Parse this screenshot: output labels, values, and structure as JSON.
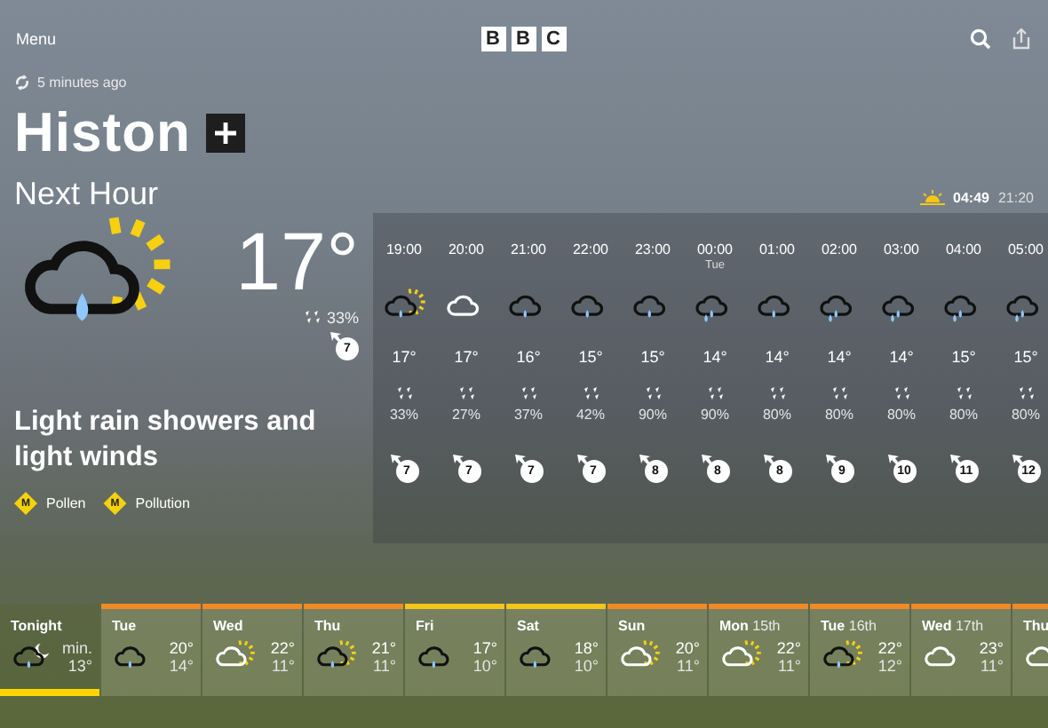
{
  "top_bar": {
    "menu": "Menu",
    "logo": [
      "B",
      "B",
      "C"
    ]
  },
  "header": {
    "updated": "5 minutes ago",
    "location": "Histon",
    "section": "Next Hour",
    "sunrise": "04:49",
    "sunset": "21:20"
  },
  "now": {
    "kind": "sun-cloud-rain",
    "temperature": "17°",
    "rain": "33%",
    "wind": "7",
    "description": "Light rain showers and light winds",
    "badges": [
      {
        "level": "M",
        "label": "Pollen"
      },
      {
        "level": "M",
        "label": "Pollution"
      }
    ]
  },
  "hours": [
    {
      "time": "19:00",
      "kind": "sun-cloud-rain",
      "temp": "17°",
      "rain": "33%",
      "wind": "7"
    },
    {
      "time": "20:00",
      "kind": "cloud",
      "temp": "17°",
      "rain": "27%",
      "wind": "7"
    },
    {
      "time": "21:00",
      "kind": "cloud-rain",
      "temp": "16°",
      "rain": "37%",
      "wind": "7"
    },
    {
      "time": "22:00",
      "kind": "cloud-rain",
      "temp": "15°",
      "rain": "42%",
      "wind": "7"
    },
    {
      "time": "23:00",
      "kind": "cloud-rain",
      "temp": "15°",
      "rain": "90%",
      "wind": "8"
    },
    {
      "time": "00:00",
      "day": "Tue",
      "kind": "cloud-heavy-rain",
      "temp": "14°",
      "rain": "90%",
      "wind": "8"
    },
    {
      "time": "01:00",
      "kind": "cloud-rain",
      "temp": "14°",
      "rain": "80%",
      "wind": "8"
    },
    {
      "time": "02:00",
      "kind": "cloud-heavy-rain",
      "temp": "14°",
      "rain": "80%",
      "wind": "9"
    },
    {
      "time": "03:00",
      "kind": "cloud-heavy-rain",
      "temp": "14°",
      "rain": "80%",
      "wind": "10"
    },
    {
      "time": "04:00",
      "kind": "cloud-heavy-rain",
      "temp": "15°",
      "rain": "80%",
      "wind": "11"
    },
    {
      "time": "05:00",
      "kind": "cloud-heavy-rain",
      "temp": "15°",
      "rain": "80%",
      "wind": "12"
    }
  ],
  "days": [
    {
      "name": "Tonight",
      "kind": "moon-cloud-rain",
      "low_label": "min.",
      "low": "13°",
      "selected": true
    },
    {
      "name": "Tue",
      "kind": "cloud-rain",
      "high": "20°",
      "low": "14°",
      "color": "#f08a24",
      "selected": false
    },
    {
      "name": "Wed",
      "kind": "sun-cloud",
      "high": "22°",
      "low": "11°",
      "color": "#f08a24",
      "selected": false
    },
    {
      "name": "Thu",
      "kind": "sun-cloud-rain",
      "high": "21°",
      "low": "11°",
      "color": "#f08a24",
      "selected": false
    },
    {
      "name": "Fri",
      "kind": "cloud-rain",
      "high": "17°",
      "low": "10°",
      "color": "#f5c518",
      "selected": false
    },
    {
      "name": "Sat",
      "kind": "cloud-rain",
      "high": "18°",
      "low": "10°",
      "color": "#f5c518",
      "selected": false
    },
    {
      "name": "Sun",
      "kind": "sun-cloud",
      "high": "20°",
      "low": "11°",
      "color": "#f08a24",
      "selected": false
    },
    {
      "name": "Mon",
      "date": "15th",
      "kind": "sun-cloud",
      "high": "22°",
      "low": "11°",
      "color": "#f08a24",
      "selected": false
    },
    {
      "name": "Tue",
      "date": "16th",
      "kind": "sun-cloud-rain",
      "high": "22°",
      "low": "12°",
      "color": "#f08a24",
      "selected": false
    },
    {
      "name": "Wed",
      "date": "17th",
      "kind": "cloud",
      "high": "23°",
      "low": "11°",
      "color": "#f08a24",
      "selected": false
    },
    {
      "name": "Thu",
      "kind": "sun-cloud",
      "color": "#f08a24",
      "selected": false
    }
  ]
}
